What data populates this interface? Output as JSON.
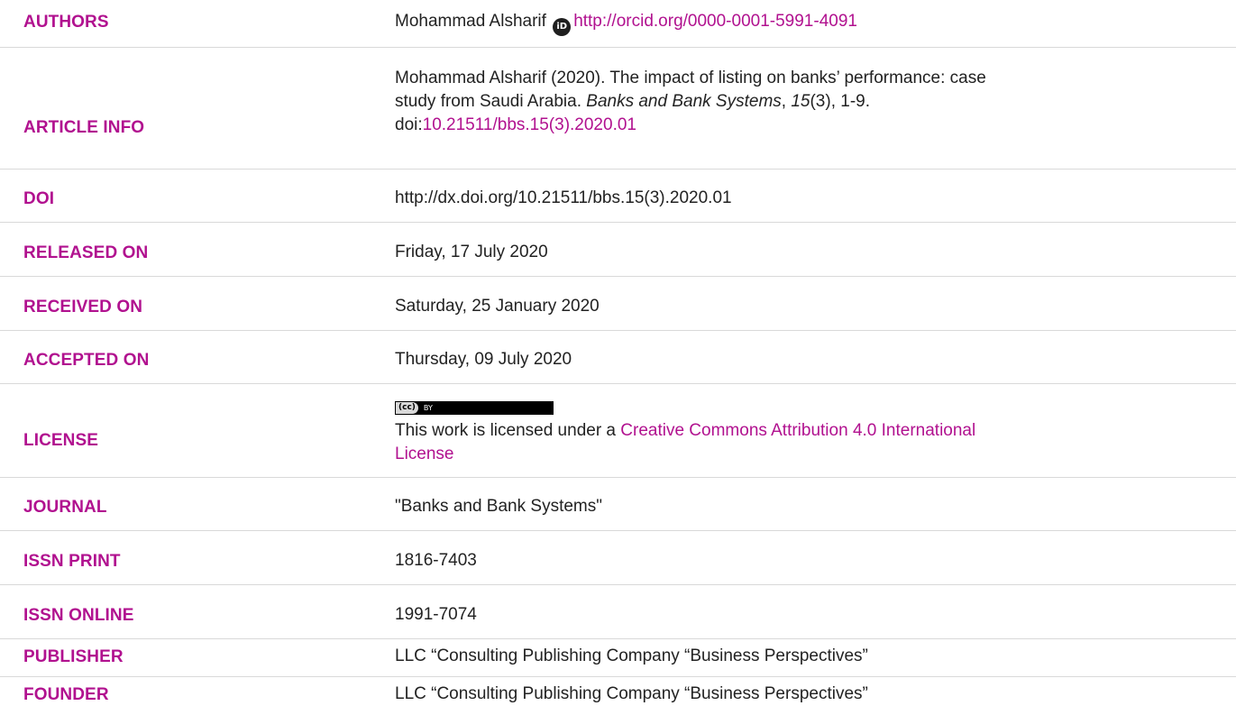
{
  "accent_color": "#b1118f",
  "rows": {
    "authors": {
      "label": "AUTHORS",
      "name": "Mohammad Alsharif",
      "orcid_icon": "iD",
      "orcid_url": "http://orcid.org/0000-0001-5991-4091"
    },
    "article_info": {
      "label": "ARTICLE INFO",
      "line1": "Mohammad Alsharif (2020). The impact of listing on banks’ performance: case",
      "line2_pre": "study from Saudi Arabia. ",
      "journal_italic": "Banks and Bank Systems",
      "comma1": ", ",
      "volume_italic": "15",
      "issue_pages": "(3), 1-9.",
      "doi_prefix": "doi:",
      "doi_link": "10.21511/bbs.15(3).2020.01"
    },
    "doi": {
      "label": "DOI",
      "value": "http://dx.doi.org/10.21511/bbs.15(3).2020.01"
    },
    "released_on": {
      "label": "RELEASED ON",
      "value": "Friday, 17 July 2020"
    },
    "received_on": {
      "label": "RECEIVED ON",
      "value": "Saturday, 25 January 2020"
    },
    "accepted_on": {
      "label": "ACCEPTED ON",
      "value": "Thursday, 09 July 2020"
    },
    "license": {
      "label": "LICENSE",
      "badge_cc": "(cc)",
      "badge_by": "BY",
      "text_pre": "This work is licensed under a ",
      "link_line1": "Creative Commons Attribution 4.0 International",
      "link_line2": "License"
    },
    "journal": {
      "label": "JOURNAL",
      "value": "\"Banks and Bank Systems\""
    },
    "issn_print": {
      "label": "ISSN PRINT",
      "value": "1816-7403"
    },
    "issn_online": {
      "label": "ISSN ONLINE",
      "value": "1991-7074"
    },
    "publisher": {
      "label": "PUBLISHER",
      "value": "LLC “Consulting Publishing Company “Business Perspectives”"
    },
    "founder": {
      "label": "FOUNDER",
      "value": "LLC “Consulting Publishing Company “Business Perspectives”"
    }
  }
}
